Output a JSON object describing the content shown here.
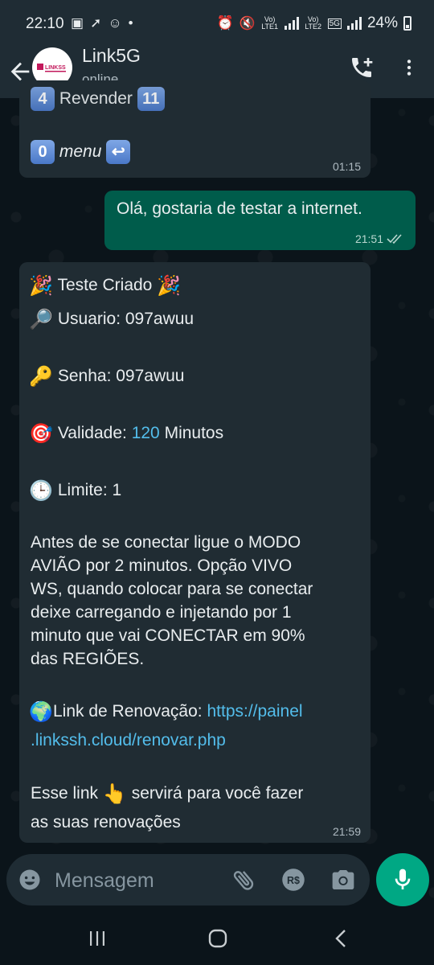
{
  "status_bar": {
    "time": "22:10",
    "battery": "24%",
    "sim1_label": "Vo) LTE1",
    "sim2_label": "Vo) LTE2",
    "network": "5G"
  },
  "header": {
    "contact_name": "Link5G",
    "contact_status": "online",
    "avatar_logo_text": "LINKSS"
  },
  "messages": {
    "first": {
      "partial_text": "Revender",
      "menu_key": "0",
      "menu_label": "menu",
      "time": "01:15"
    },
    "sent": {
      "text": "Olá, gostaria de testar a internet.",
      "time": "21:51"
    },
    "reply": {
      "title": "Teste Criado",
      "user_label": "Usuario: 097awuu",
      "password_label": "Senha: 097awuu",
      "validity_prefix": "Validade: ",
      "validity_value": "120",
      "validity_suffix": " Minutos",
      "limit_label": "Limite: 1",
      "instructions_1": "Antes de se conectar ligue o MODO",
      "instructions_2": "AVIÃO por 2 minutos. Opção VIVO",
      "instructions_3": "WS, quando colocar para se conectar",
      "instructions_4": "deixe carregando e injetando por 1",
      "instructions_5": "minuto que vai CONECTAR em 90%",
      "instructions_6": "das REGIÕES.",
      "renewal_label": "Link de Renovação: ",
      "renewal_link_1": "https://painel",
      "renewal_link_2": ".linkssh.cloud/renovar.php",
      "closing_1a": "Esse link",
      "closing_1b": "servirá para você fazer",
      "closing_2": "as suas renovações",
      "time": "21:59"
    }
  },
  "input": {
    "placeholder": "Mensagem"
  },
  "colors": {
    "background": "#0b141a",
    "header": "#1f2c34",
    "incoming_bubble": "#202c33",
    "outgoing_bubble": "#005c4b",
    "accent": "#00a884",
    "link": "#53bdeb"
  },
  "icons": {
    "back": "arrow-left-icon",
    "call_add": "call-add-icon",
    "more": "more-vertical-icon",
    "emoji": "emoji-icon",
    "attach": "paperclip-icon",
    "pay": "payment-icon",
    "camera": "camera-icon",
    "mic": "microphone-icon"
  }
}
